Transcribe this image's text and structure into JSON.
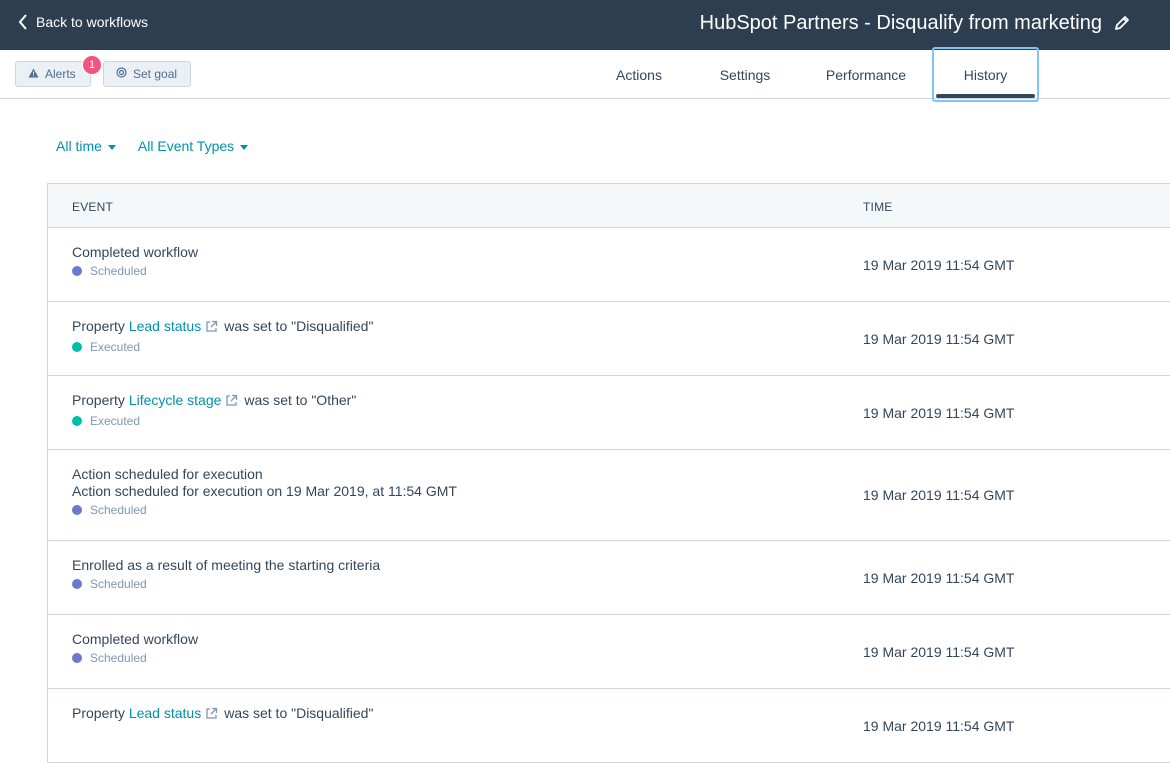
{
  "topbar": {
    "back_label": "Back to workflows",
    "workflow_title": "HubSpot Partners - Disqualify from marketing"
  },
  "subbar": {
    "alerts_label": "Alerts",
    "alerts_count": "1",
    "set_goal_label": "Set goal",
    "tabs": [
      {
        "label": "Actions"
      },
      {
        "label": "Settings"
      },
      {
        "label": "Performance"
      },
      {
        "label": "History",
        "active": true
      }
    ]
  },
  "filters": {
    "time_label": "All time",
    "event_types_label": "All Event Types"
  },
  "table": {
    "headers": {
      "event": "EVENT",
      "time": "TIME"
    },
    "status_colors": {
      "Scheduled": "#6a78d1",
      "Executed": "#00bda5"
    },
    "rows": [
      {
        "line1": "Completed workflow",
        "status": "Scheduled",
        "time": "19 Mar 2019 11:54 GMT"
      },
      {
        "prefix": "Property",
        "link": "Lead status",
        "suffix": "was set to \"Disqualified\"",
        "status": "Executed",
        "time": "19 Mar 2019 11:54 GMT"
      },
      {
        "prefix": "Property",
        "link": "Lifecycle stage",
        "suffix": "was set to \"Other\"",
        "status": "Executed",
        "time": "19 Mar 2019 11:54 GMT"
      },
      {
        "line1": "Action scheduled for execution",
        "line2": "Action scheduled for execution on 19 Mar 2019, at 11:54 GMT",
        "status": "Scheduled",
        "time": "19 Mar 2019 11:54 GMT"
      },
      {
        "line1": "Enrolled as a result of meeting the starting criteria",
        "status": "Scheduled",
        "time": "19 Mar 2019 11:54 GMT"
      },
      {
        "line1": "Completed workflow",
        "status": "Scheduled",
        "time": "19 Mar 2019 11:54 GMT"
      },
      {
        "prefix": "Property",
        "link": "Lead status",
        "suffix": "was set to \"Disqualified\"",
        "status": "",
        "time": "19 Mar 2019 11:54 GMT"
      }
    ]
  },
  "icons": {
    "back": "chevron-left-icon",
    "edit": "pencil-icon",
    "alerts": "warning-icon",
    "goal": "target-icon",
    "external": "external-link-icon"
  }
}
